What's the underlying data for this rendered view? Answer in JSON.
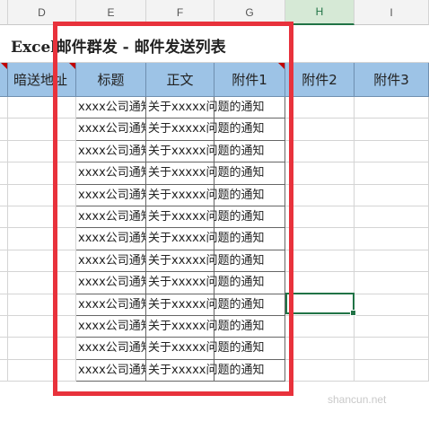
{
  "column_letters": [
    "D",
    "E",
    "F",
    "G",
    "H",
    "I"
  ],
  "selected_column": "H",
  "sheet_title": "Excel邮件群发 - 邮件发送列表",
  "headers": [
    "暗送地址",
    "标题",
    "正文",
    "附件1",
    "附件2",
    "附件3"
  ],
  "row_values": {
    "title": "xxxx公司通知",
    "body": "关于xxxxx问题的通知"
  },
  "row_count": 13,
  "watermark": "shancun.net",
  "colors": {
    "header_fill": "#9dc3e6",
    "highlight_box": "#e8323c",
    "selection": "#217346"
  }
}
